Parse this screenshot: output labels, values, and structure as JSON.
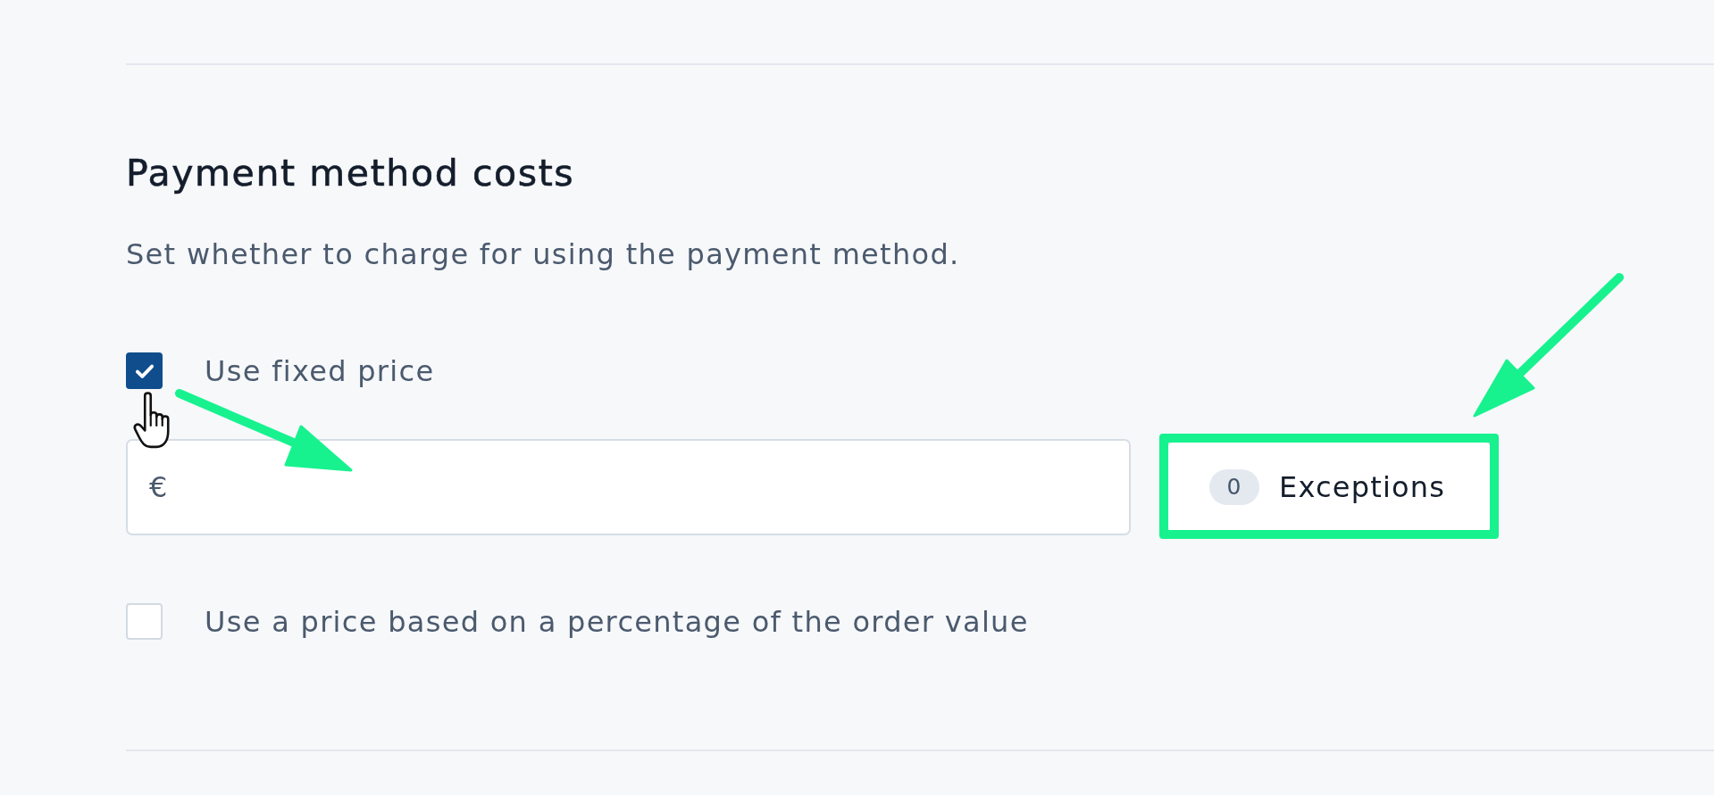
{
  "section": {
    "title": "Payment method costs",
    "description": "Set whether to charge for using the payment method."
  },
  "options": [
    {
      "kind": "checkbox",
      "label": "Use fixed price",
      "checked": true,
      "price_field": {
        "prefix": "€"
      },
      "exceptions_button": {
        "count": "0",
        "label": "Exceptions",
        "highlighted": true
      }
    },
    {
      "kind": "checkbox",
      "label": "Use a price based on a percentage of the order value",
      "checked": false
    }
  ]
}
